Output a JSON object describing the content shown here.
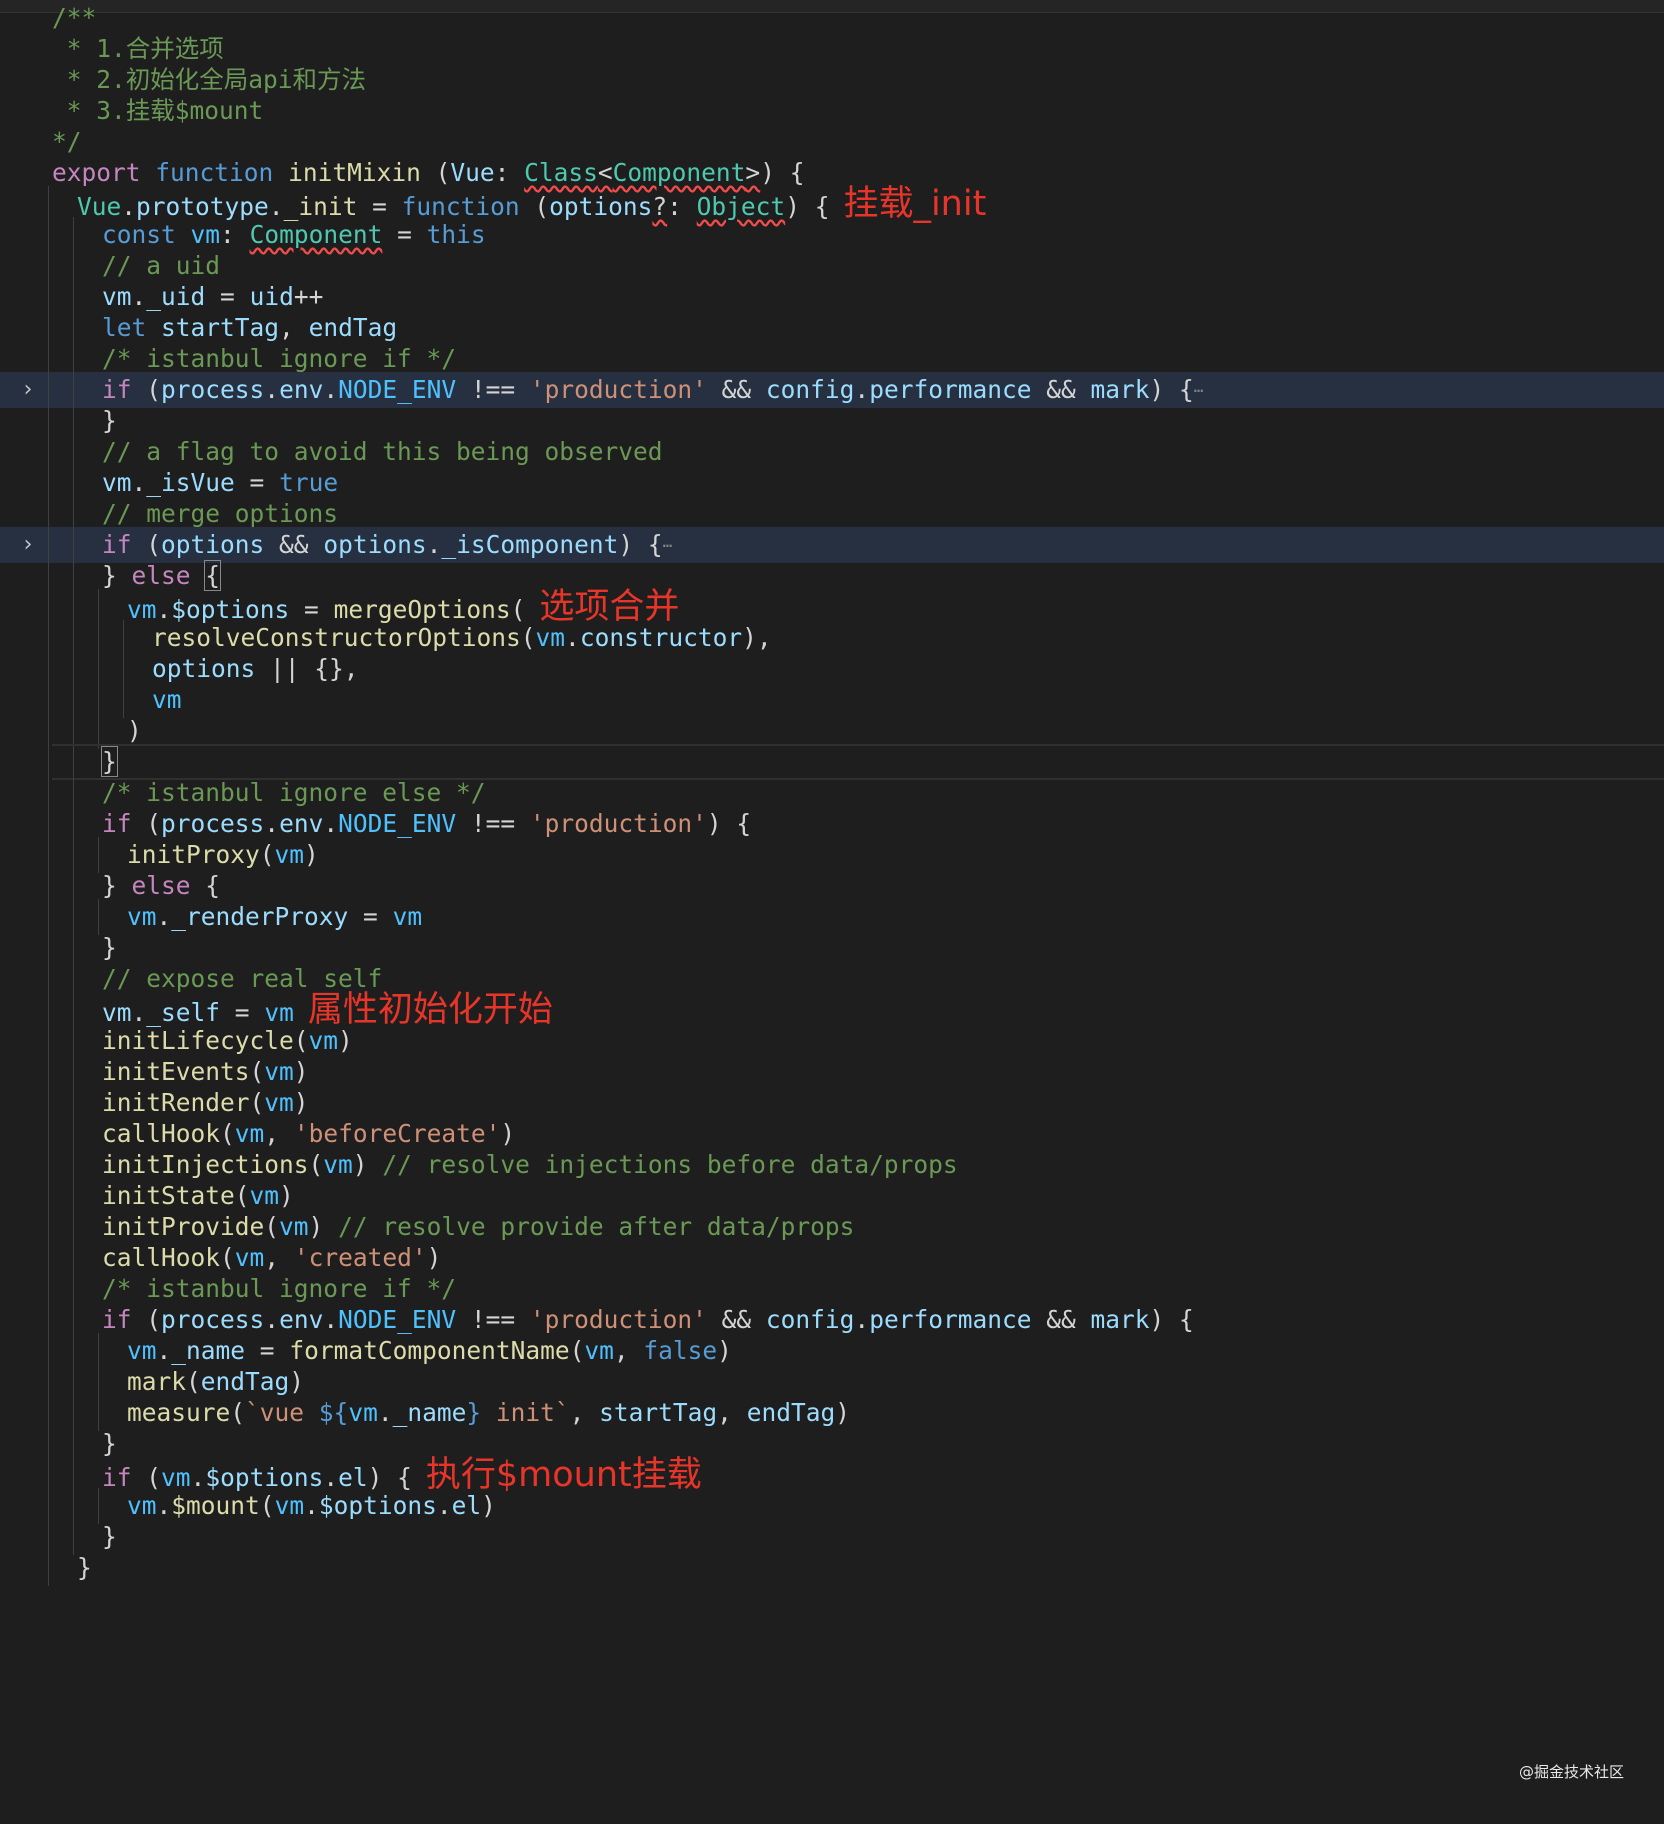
{
  "editor": {
    "colors": {
      "background": "#1e1e1e",
      "keyword": "#569cd6",
      "control": "#c586c0",
      "function": "#dcdcaa",
      "variable": "#9cdcfe",
      "string": "#ce9178",
      "comment": "#6a9955",
      "type": "#4ec9b0",
      "annotation": "#e8352a"
    },
    "folded_indicator": "…",
    "lines": [
      {
        "indent": 1,
        "tokens": [
          [
            "m",
            "/**"
          ]
        ]
      },
      {
        "indent": 1,
        "tokens": [
          [
            "m",
            " * 1.合并选项"
          ]
        ]
      },
      {
        "indent": 1,
        "tokens": [
          [
            "m",
            " * 2.初始化全局api和方法"
          ]
        ]
      },
      {
        "indent": 1,
        "tokens": [
          [
            "m",
            " * 3.挂载$mount"
          ]
        ]
      },
      {
        "indent": 1,
        "tokens": [
          [
            "m",
            "*/"
          ]
        ]
      },
      {
        "indent": 1,
        "tokens": [
          [
            "c",
            "export"
          ],
          [
            "p",
            " "
          ],
          [
            "k",
            "function"
          ],
          [
            "p",
            " "
          ],
          [
            "f",
            "initMixin"
          ],
          [
            "p",
            " ("
          ],
          [
            "v",
            "Vue"
          ],
          [
            "p",
            ": "
          ],
          [
            "ty err",
            "Class"
          ],
          [
            "p err",
            "<"
          ],
          [
            "ty err",
            "Component"
          ],
          [
            "p err",
            ">"
          ],
          [
            "p",
            ") {"
          ]
        ]
      },
      {
        "indent": 2,
        "tokens": [
          [
            "ty",
            "Vue"
          ],
          [
            "p",
            "."
          ],
          [
            "v",
            "prototype"
          ],
          [
            "p",
            "."
          ],
          [
            "f",
            "_init"
          ],
          [
            "p",
            " = "
          ],
          [
            "k",
            "function"
          ],
          [
            "p",
            " ("
          ],
          [
            "v",
            "options"
          ],
          [
            "p err",
            "?"
          ],
          [
            "p",
            ": "
          ],
          [
            "ty err",
            "Object"
          ],
          [
            "p",
            ") {"
          ]
        ],
        "annotation": "挂载_init"
      },
      {
        "indent": 3,
        "tokens": [
          [
            "k",
            "const"
          ],
          [
            "p",
            " "
          ],
          [
            "cn",
            "vm"
          ],
          [
            "p",
            ": "
          ],
          [
            "ty err",
            "Component"
          ],
          [
            "p",
            " = "
          ],
          [
            "k",
            "this"
          ]
        ]
      },
      {
        "indent": 3,
        "tokens": [
          [
            "m",
            "// a uid"
          ]
        ]
      },
      {
        "indent": 3,
        "tokens": [
          [
            "v",
            "vm"
          ],
          [
            "p",
            "."
          ],
          [
            "v",
            "_uid"
          ],
          [
            "p",
            " = "
          ],
          [
            "v",
            "uid"
          ],
          [
            "p",
            "++"
          ]
        ]
      },
      {
        "indent": 3,
        "tokens": [
          [
            "k",
            "let"
          ],
          [
            "p",
            " "
          ],
          [
            "v",
            "startTag"
          ],
          [
            "p",
            ", "
          ],
          [
            "v",
            "endTag"
          ]
        ]
      },
      {
        "indent": 3,
        "tokens": [
          [
            "m",
            "/* istanbul ignore if */"
          ]
        ]
      },
      {
        "indent": 3,
        "folded": true,
        "highlight": true,
        "tokens": [
          [
            "c",
            "if"
          ],
          [
            "p",
            " ("
          ],
          [
            "v",
            "process"
          ],
          [
            "p",
            "."
          ],
          [
            "v",
            "env"
          ],
          [
            "p",
            "."
          ],
          [
            "cn",
            "NODE_ENV"
          ],
          [
            "p",
            " !== "
          ],
          [
            "s",
            "'production'"
          ],
          [
            "p",
            " && "
          ],
          [
            "v",
            "config"
          ],
          [
            "p",
            "."
          ],
          [
            "v",
            "performance"
          ],
          [
            "p",
            " && "
          ],
          [
            "v",
            "mark"
          ],
          [
            "p",
            ") {"
          ]
        ]
      },
      {
        "indent": 3,
        "tokens": [
          [
            "p",
            "}"
          ]
        ]
      },
      {
        "indent": 3,
        "tokens": [
          [
            "m",
            "// a flag to avoid this being observed"
          ]
        ]
      },
      {
        "indent": 3,
        "tokens": [
          [
            "v",
            "vm"
          ],
          [
            "p",
            "."
          ],
          [
            "v",
            "_isVue"
          ],
          [
            "p",
            " = "
          ],
          [
            "k",
            "true"
          ]
        ]
      },
      {
        "indent": 3,
        "tokens": [
          [
            "m",
            "// merge options"
          ]
        ]
      },
      {
        "indent": 3,
        "folded": true,
        "highlight": true,
        "tokens": [
          [
            "c",
            "if"
          ],
          [
            "p",
            " ("
          ],
          [
            "v",
            "options"
          ],
          [
            "p",
            " && "
          ],
          [
            "v",
            "options"
          ],
          [
            "p",
            "."
          ],
          [
            "v",
            "_isComponent"
          ],
          [
            "p",
            ") {"
          ]
        ]
      },
      {
        "indent": 3,
        "tokens": [
          [
            "p",
            "} "
          ],
          [
            "c",
            "else"
          ],
          [
            "p",
            " "
          ],
          [
            "p bm",
            "{"
          ]
        ]
      },
      {
        "indent": 4,
        "tokens": [
          [
            "cn",
            "vm"
          ],
          [
            "p",
            "."
          ],
          [
            "v",
            "$options"
          ],
          [
            "p",
            " = "
          ],
          [
            "f",
            "mergeOptions"
          ],
          [
            "p",
            "("
          ]
        ],
        "annotation": "选项合并"
      },
      {
        "indent": 5,
        "tokens": [
          [
            "f",
            "resolveConstructorOptions"
          ],
          [
            "p",
            "("
          ],
          [
            "cn",
            "vm"
          ],
          [
            "p",
            "."
          ],
          [
            "v",
            "constructor"
          ],
          [
            "p",
            "),"
          ]
        ]
      },
      {
        "indent": 5,
        "tokens": [
          [
            "v",
            "options"
          ],
          [
            "p",
            " || {},"
          ]
        ]
      },
      {
        "indent": 5,
        "tokens": [
          [
            "cn",
            "vm"
          ]
        ]
      },
      {
        "indent": 4,
        "tokens": [
          [
            "p",
            ")"
          ]
        ]
      },
      {
        "indent": 3,
        "current": true,
        "tokens": [
          [
            "p bm",
            "}"
          ]
        ]
      },
      {
        "indent": 3,
        "tokens": [
          [
            "m",
            "/* istanbul ignore else */"
          ]
        ]
      },
      {
        "indent": 3,
        "tokens": [
          [
            "c",
            "if"
          ],
          [
            "p",
            " ("
          ],
          [
            "v",
            "process"
          ],
          [
            "p",
            "."
          ],
          [
            "v",
            "env"
          ],
          [
            "p",
            "."
          ],
          [
            "cn",
            "NODE_ENV"
          ],
          [
            "p",
            " !== "
          ],
          [
            "s",
            "'production'"
          ],
          [
            "p",
            ") {"
          ]
        ]
      },
      {
        "indent": 4,
        "tokens": [
          [
            "f",
            "initProxy"
          ],
          [
            "p",
            "("
          ],
          [
            "cn",
            "vm"
          ],
          [
            "p",
            ")"
          ]
        ]
      },
      {
        "indent": 3,
        "tokens": [
          [
            "p",
            "} "
          ],
          [
            "c",
            "else"
          ],
          [
            "p",
            " {"
          ]
        ]
      },
      {
        "indent": 4,
        "tokens": [
          [
            "cn",
            "vm"
          ],
          [
            "p",
            "."
          ],
          [
            "v",
            "_renderProxy"
          ],
          [
            "p",
            " = "
          ],
          [
            "cn",
            "vm"
          ]
        ]
      },
      {
        "indent": 3,
        "tokens": [
          [
            "p",
            "}"
          ]
        ]
      },
      {
        "indent": 3,
        "tokens": [
          [
            "m",
            "// expose real self"
          ]
        ]
      },
      {
        "indent": 3,
        "tokens": [
          [
            "v",
            "vm"
          ],
          [
            "p",
            "."
          ],
          [
            "v",
            "_self"
          ],
          [
            "p",
            " = "
          ],
          [
            "cn",
            "vm"
          ]
        ],
        "annotation": "属性初始化开始"
      },
      {
        "indent": 3,
        "tokens": [
          [
            "f",
            "initLifecycle"
          ],
          [
            "p",
            "("
          ],
          [
            "cn",
            "vm"
          ],
          [
            "p",
            ")"
          ]
        ]
      },
      {
        "indent": 3,
        "tokens": [
          [
            "f",
            "initEvents"
          ],
          [
            "p",
            "("
          ],
          [
            "cn",
            "vm"
          ],
          [
            "p",
            ")"
          ]
        ]
      },
      {
        "indent": 3,
        "tokens": [
          [
            "f",
            "initRender"
          ],
          [
            "p",
            "("
          ],
          [
            "cn",
            "vm"
          ],
          [
            "p",
            ")"
          ]
        ]
      },
      {
        "indent": 3,
        "tokens": [
          [
            "f",
            "callHook"
          ],
          [
            "p",
            "("
          ],
          [
            "cn",
            "vm"
          ],
          [
            "p",
            ", "
          ],
          [
            "s",
            "'beforeCreate'"
          ],
          [
            "p",
            ")"
          ]
        ]
      },
      {
        "indent": 3,
        "tokens": [
          [
            "f",
            "initInjections"
          ],
          [
            "p",
            "("
          ],
          [
            "cn",
            "vm"
          ],
          [
            "p",
            ") "
          ],
          [
            "m",
            "// resolve injections before data/props"
          ]
        ]
      },
      {
        "indent": 3,
        "tokens": [
          [
            "f",
            "initState"
          ],
          [
            "p",
            "("
          ],
          [
            "cn",
            "vm"
          ],
          [
            "p",
            ")"
          ]
        ]
      },
      {
        "indent": 3,
        "tokens": [
          [
            "f",
            "initProvide"
          ],
          [
            "p",
            "("
          ],
          [
            "cn",
            "vm"
          ],
          [
            "p",
            ") "
          ],
          [
            "m",
            "// resolve provide after data/props"
          ]
        ]
      },
      {
        "indent": 3,
        "tokens": [
          [
            "f",
            "callHook"
          ],
          [
            "p",
            "("
          ],
          [
            "cn",
            "vm"
          ],
          [
            "p",
            ", "
          ],
          [
            "s",
            "'created'"
          ],
          [
            "p",
            ")"
          ]
        ]
      },
      {
        "indent": 3,
        "tokens": [
          [
            "m",
            "/* istanbul ignore if */"
          ]
        ]
      },
      {
        "indent": 3,
        "tokens": [
          [
            "c",
            "if"
          ],
          [
            "p",
            " ("
          ],
          [
            "v",
            "process"
          ],
          [
            "p",
            "."
          ],
          [
            "v",
            "env"
          ],
          [
            "p",
            "."
          ],
          [
            "cn",
            "NODE_ENV"
          ],
          [
            "p",
            " !== "
          ],
          [
            "s",
            "'production'"
          ],
          [
            "p",
            " && "
          ],
          [
            "v",
            "config"
          ],
          [
            "p",
            "."
          ],
          [
            "v",
            "performance"
          ],
          [
            "p",
            " && "
          ],
          [
            "v",
            "mark"
          ],
          [
            "p",
            ") {"
          ]
        ]
      },
      {
        "indent": 4,
        "tokens": [
          [
            "cn",
            "vm"
          ],
          [
            "p",
            "."
          ],
          [
            "v",
            "_name"
          ],
          [
            "p",
            " = "
          ],
          [
            "f",
            "formatComponentName"
          ],
          [
            "p",
            "("
          ],
          [
            "cn",
            "vm"
          ],
          [
            "p",
            ", "
          ],
          [
            "k",
            "false"
          ],
          [
            "p",
            ")"
          ]
        ]
      },
      {
        "indent": 4,
        "tokens": [
          [
            "f",
            "mark"
          ],
          [
            "p",
            "("
          ],
          [
            "v",
            "endTag"
          ],
          [
            "p",
            ")"
          ]
        ]
      },
      {
        "indent": 4,
        "tokens": [
          [
            "f",
            "measure"
          ],
          [
            "p",
            "("
          ],
          [
            "s",
            "`vue "
          ],
          [
            "k",
            "${"
          ],
          [
            "cn",
            "vm"
          ],
          [
            "p",
            "."
          ],
          [
            "v",
            "_name"
          ],
          [
            "k",
            "}"
          ],
          [
            "s",
            " init`"
          ],
          [
            "p",
            ", "
          ],
          [
            "v",
            "startTag"
          ],
          [
            "p",
            ", "
          ],
          [
            "v",
            "endTag"
          ],
          [
            "p",
            ")"
          ]
        ]
      },
      {
        "indent": 3,
        "tokens": [
          [
            "p",
            "}"
          ]
        ]
      },
      {
        "indent": 3,
        "tokens": [
          [
            "c",
            "if"
          ],
          [
            "p",
            " ("
          ],
          [
            "cn",
            "vm"
          ],
          [
            "p",
            "."
          ],
          [
            "v",
            "$options"
          ],
          [
            "p",
            "."
          ],
          [
            "v",
            "el"
          ],
          [
            "p",
            ") {"
          ]
        ],
        "annotation": "执行$mount挂载"
      },
      {
        "indent": 4,
        "tokens": [
          [
            "cn",
            "vm"
          ],
          [
            "p",
            "."
          ],
          [
            "f",
            "$mount"
          ],
          [
            "p",
            "("
          ],
          [
            "cn",
            "vm"
          ],
          [
            "p",
            "."
          ],
          [
            "v",
            "$options"
          ],
          [
            "p",
            "."
          ],
          [
            "v",
            "el"
          ],
          [
            "p",
            ")"
          ]
        ]
      },
      {
        "indent": 3,
        "tokens": [
          [
            "p",
            "}"
          ]
        ]
      },
      {
        "indent": 2,
        "tokens": [
          [
            "p",
            "}"
          ]
        ]
      }
    ]
  },
  "watermark": "@掘金技术社区"
}
